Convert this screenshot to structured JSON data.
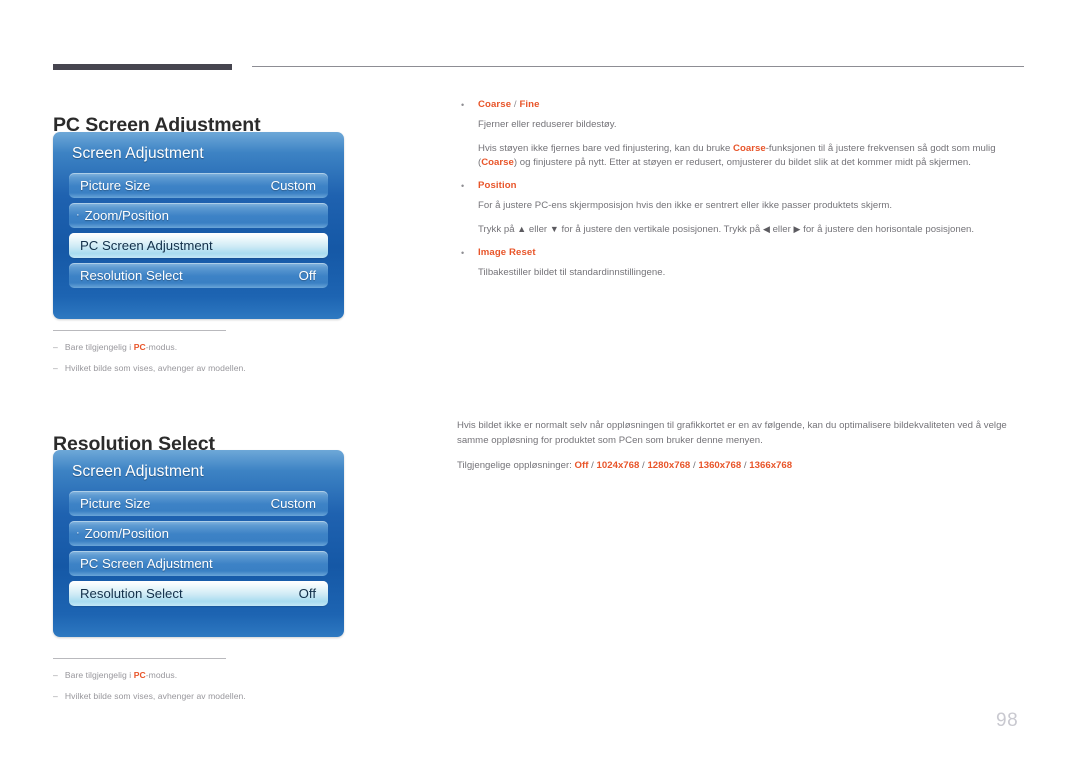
{
  "page": {
    "number": "98"
  },
  "sections": [
    {
      "heading": "PC Screen Adjustment",
      "menu": {
        "title": "Screen Adjustment",
        "rows": [
          {
            "label": "Picture Size",
            "value": "Custom",
            "selected": false,
            "dot": ""
          },
          {
            "label": "Zoom/Position",
            "value": "",
            "selected": false,
            "dot": "·"
          },
          {
            "label": "PC Screen Adjustment",
            "value": "",
            "selected": true,
            "dot": ""
          },
          {
            "label": "Resolution Select",
            "value": "Off",
            "selected": false,
            "dot": ""
          }
        ]
      },
      "footnotes": [
        {
          "dash": "–",
          "pre": "Bare tilgjengelig i ",
          "bold": "PC",
          "post": "-modus."
        },
        {
          "dash": "–",
          "pre": "Hvilket bilde som vises, avhenger av modellen.",
          "bold": "",
          "post": ""
        }
      ]
    },
    {
      "heading": "Resolution Select",
      "menu": {
        "title": "Screen Adjustment",
        "rows": [
          {
            "label": "Picture Size",
            "value": "Custom",
            "selected": false,
            "dot": ""
          },
          {
            "label": "Zoom/Position",
            "value": "",
            "selected": false,
            "dot": "·"
          },
          {
            "label": "PC Screen Adjustment",
            "value": "",
            "selected": false,
            "dot": ""
          },
          {
            "label": "Resolution Select",
            "value": "Off",
            "selected": true,
            "dot": ""
          }
        ]
      },
      "footnotes": [
        {
          "dash": "–",
          "pre": "Bare tilgjengelig i ",
          "bold": "PC",
          "post": "-modus."
        },
        {
          "dash": "–",
          "pre": "Hvilket bilde som vises, avhenger av modellen.",
          "bold": "",
          "post": ""
        }
      ]
    }
  ],
  "body_top": {
    "bullets": [
      {
        "mark": "•",
        "title_main": "Coarse",
        "title_sep": " / ",
        "title_second": "Fine",
        "paragraphs": [
          "Fjerner eller reduserer bildestøy."
        ],
        "rich_paragraph": {
          "p1": "Hvis støyen ikke fjernes bare ved finjustering, kan du bruke ",
          "b1": "Coarse",
          "p2": "-funksjonen til å justere frekvensen så godt som mulig (",
          "b2": "Coarse",
          "p3": ") og finjustere på nytt. Etter at støyen er redusert, omjusterer du bildet slik at det kommer midt på skjermen."
        }
      },
      {
        "mark": "•",
        "title_main": "Position",
        "title_sep": "",
        "title_second": "",
        "paragraphs": [
          "For å justere PC-ens skjermposisjon hvis den ikke er sentrert eller ikke passer produktets skjerm."
        ],
        "arrow_paragraph": {
          "p1": "Trykk på ",
          "a1": "▲",
          "p2": " eller ",
          "a2": "▼",
          "p3": " for å justere den vertikale posisjonen. Trykk på ",
          "a3": "◀",
          "p4": " eller ",
          "a4": "▶",
          "p5": " for å justere den horisontale posisjonen."
        }
      },
      {
        "mark": "•",
        "title_main": "Image Reset",
        "title_sep": "",
        "title_second": "",
        "paragraphs": [
          "Tilbakestiller bildet til standardinnstillingene."
        ]
      }
    ]
  },
  "body_bottom": {
    "intro": "Hvis bildet ikke er normalt selv når oppløsningen til grafikkortet er en av følgende, kan du optimalisere bildekvaliteten ved å velge samme oppløsning for produktet som PCen som bruker denne menyen.",
    "resolutions_label": "Tilgjengelige oppløsninger: ",
    "resolutions": [
      "Off",
      "1024x768",
      "1280x768",
      "1360x768",
      "1366x768"
    ],
    "resolutions_separator": " / "
  },
  "colors": {
    "accent_orange": "#e8552a",
    "body_gray": "#747378",
    "heading_dark": "#2b2b2b",
    "osd_blue": "#1558a6",
    "page_number_gray": "#c9c9d0"
  }
}
